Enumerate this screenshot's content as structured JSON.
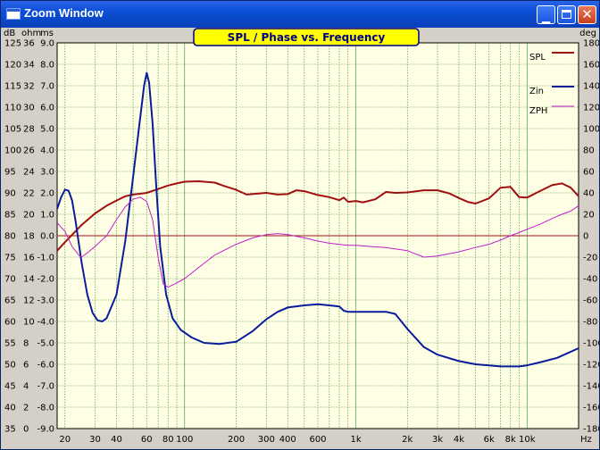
{
  "window": {
    "title": "Zoom Window",
    "close_label": "✕",
    "minimize_label": "▁"
  },
  "chart_data": {
    "type": "line",
    "title": "SPL / Phase vs. Frequency",
    "xscale": "log",
    "xlim": [
      18,
      20000
    ],
    "xlabel": "Hz",
    "x_ticks": [
      20,
      30,
      40,
      60,
      80,
      100,
      200,
      300,
      400,
      600,
      1000,
      2000,
      3000,
      4000,
      6000,
      8000,
      10000
    ],
    "x_tick_labels": [
      "20",
      "30",
      "40",
      "60",
      "80",
      "100",
      "200",
      "300",
      "400",
      "600",
      "1k",
      "2k",
      "3k",
      "4k",
      "6k",
      "8k",
      "10k"
    ],
    "left_axes": [
      {
        "label": "dB",
        "range": [
          35,
          125
        ],
        "ticks": [
          125,
          120,
          115,
          110,
          105,
          100,
          95,
          90,
          85,
          80,
          75,
          70,
          65,
          60,
          55,
          50,
          45,
          40,
          35
        ]
      },
      {
        "label": "ohm",
        "range": [
          0,
          36
        ],
        "ticks": [
          "36",
          "34",
          "32",
          "30",
          "28",
          "26",
          "24",
          "22",
          "20",
          "18",
          "16",
          "14",
          "12",
          "10",
          "8",
          "6",
          "4",
          "2",
          "0"
        ]
      },
      {
        "label": "ms",
        "range": [
          -9.0,
          9.0
        ],
        "ticks": [
          "9.0",
          "8.0",
          "7.0",
          "6.0",
          "5.0",
          "4.0",
          "3.0",
          "2.0",
          "1.0",
          "0.0",
          "-1.0",
          "-2.0",
          "-3.0",
          "-4.0",
          "-5.0",
          "-6.0",
          "-7.0",
          "-8.0",
          "-9.0"
        ]
      }
    ],
    "right_axis": {
      "label": "deg",
      "range": [
        -180,
        180
      ],
      "ticks": [
        "180",
        "160",
        "140",
        "120",
        "100",
        "80",
        "60",
        "40",
        "20",
        "0",
        "-20",
        "-40",
        "-60",
        "-80",
        "-100",
        "-120",
        "-140",
        "-160",
        "-180"
      ]
    },
    "grid": true,
    "zero_line": "deg 0",
    "legend_position": "top-right",
    "series": [
      {
        "name": "SPL",
        "color": "#a01010",
        "axis": "dB",
        "x": [
          18,
          20,
          25,
          30,
          35,
          40,
          45,
          50,
          55,
          60,
          70,
          80,
          90,
          100,
          120,
          150,
          170,
          200,
          230,
          300,
          350,
          400,
          450,
          500,
          600,
          700,
          800,
          850,
          900,
          1000,
          1100,
          1300,
          1500,
          1700,
          2000,
          2500,
          3000,
          3500,
          4000,
          4500,
          5000,
          6000,
          7000,
          8000,
          9000,
          10000,
          12000,
          14000,
          16000,
          18000,
          20000
        ],
        "y": [
          76.5,
          78.5,
          82.5,
          85.2,
          87,
          88.2,
          89.2,
          89.6,
          89.8,
          90,
          90.9,
          91.7,
          92.2,
          92.6,
          92.7,
          92.4,
          91.6,
          90.7,
          89.6,
          90,
          89.6,
          89.7,
          90.6,
          90.4,
          89.5,
          89,
          88.3,
          88.9,
          87.9,
          88.1,
          87.8,
          88.5,
          90.2,
          90,
          90.1,
          90.6,
          90.6,
          89.9,
          88.8,
          87.9,
          87.5,
          88.7,
          91.2,
          91.4,
          89,
          88.9,
          90.5,
          91.8,
          92.2,
          91.2,
          89.2
        ]
      },
      {
        "name": "Zin",
        "color": "#0a1c9c",
        "axis": "ohm",
        "x": [
          18,
          19,
          20,
          21,
          22,
          23,
          25,
          27,
          29,
          31,
          33,
          35,
          40,
          45,
          50,
          55,
          58,
          60,
          62,
          65,
          68,
          72,
          78,
          85,
          95,
          110,
          130,
          160,
          200,
          250,
          300,
          350,
          400,
          500,
          600,
          700,
          800,
          850,
          900,
          1000,
          1200,
          1500,
          1700,
          2000,
          2500,
          3000,
          4000,
          5000,
          6000,
          7000,
          8000,
          9000,
          10000,
          12000,
          15000,
          20000
        ],
        "y": [
          20.5,
          21.6,
          22.3,
          22.2,
          21.3,
          19.5,
          15.5,
          12.5,
          10.8,
          10.1,
          10,
          10.3,
          12.5,
          17.5,
          23.5,
          29,
          32,
          33.2,
          32.3,
          28.5,
          23,
          17,
          12.5,
          10.3,
          9.2,
          8.5,
          8,
          7.9,
          8.1,
          9.1,
          10.2,
          10.9,
          11.3,
          11.5,
          11.6,
          11.5,
          11.4,
          11,
          10.9,
          10.9,
          10.9,
          10.9,
          10.7,
          9.3,
          7.6,
          6.9,
          6.3,
          6,
          5.9,
          5.8,
          5.8,
          5.8,
          5.9,
          6.2,
          6.6,
          7.5
        ]
      },
      {
        "name": "ZPH",
        "color": "#c01ec8",
        "axis": "deg",
        "x": [
          18,
          20,
          22,
          24,
          25,
          26,
          27,
          30,
          35,
          40,
          45,
          50,
          55,
          60,
          65,
          70,
          75,
          80,
          85,
          90,
          100,
          120,
          150,
          200,
          250,
          300,
          350,
          400,
          500,
          600,
          700,
          800,
          900,
          1000,
          1200,
          1500,
          2000,
          2500,
          3000,
          4000,
          5000,
          6000,
          7000,
          8000,
          9000,
          10000,
          12000,
          14000,
          16000,
          18000,
          20000
        ],
        "y": [
          12,
          4,
          -10,
          -18,
          -20,
          -18,
          -16,
          -10,
          0,
          15,
          27,
          34,
          36,
          32,
          15,
          -20,
          -45,
          -48,
          -46,
          -44,
          -40,
          -30,
          -18,
          -8,
          -2,
          1,
          2,
          1,
          -2,
          -5,
          -7,
          -8,
          -9,
          -9,
          -10,
          -11,
          -14,
          -20,
          -19,
          -15,
          -11,
          -8,
          -4,
          0,
          3,
          6,
          11,
          16,
          20,
          23,
          28
        ]
      }
    ]
  }
}
